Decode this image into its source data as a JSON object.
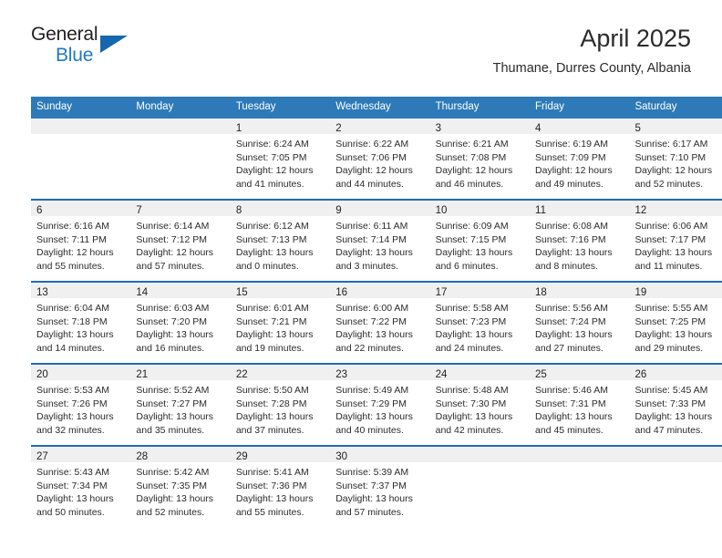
{
  "brand": {
    "line1": "General",
    "line2": "Blue",
    "triangle_color": "#1767ad",
    "blue_color": "#1f7ac0"
  },
  "header": {
    "month_title": "April 2025",
    "location": "Thumane, Durres County, Albania"
  },
  "theme": {
    "header_blue": "#2e7ab8",
    "row_border_blue": "#1f6cb0",
    "daynum_band": "#f0f0f0"
  },
  "weekday_headers": [
    "Sunday",
    "Monday",
    "Tuesday",
    "Wednesday",
    "Thursday",
    "Friday",
    "Saturday"
  ],
  "weeks": [
    [
      {
        "day": "",
        "lines": []
      },
      {
        "day": "",
        "lines": []
      },
      {
        "day": "1",
        "lines": [
          "Sunrise: 6:24 AM",
          "Sunset: 7:05 PM",
          "Daylight: 12 hours",
          "and 41 minutes."
        ]
      },
      {
        "day": "2",
        "lines": [
          "Sunrise: 6:22 AM",
          "Sunset: 7:06 PM",
          "Daylight: 12 hours",
          "and 44 minutes."
        ]
      },
      {
        "day": "3",
        "lines": [
          "Sunrise: 6:21 AM",
          "Sunset: 7:08 PM",
          "Daylight: 12 hours",
          "and 46 minutes."
        ]
      },
      {
        "day": "4",
        "lines": [
          "Sunrise: 6:19 AM",
          "Sunset: 7:09 PM",
          "Daylight: 12 hours",
          "and 49 minutes."
        ]
      },
      {
        "day": "5",
        "lines": [
          "Sunrise: 6:17 AM",
          "Sunset: 7:10 PM",
          "Daylight: 12 hours",
          "and 52 minutes."
        ]
      }
    ],
    [
      {
        "day": "6",
        "lines": [
          "Sunrise: 6:16 AM",
          "Sunset: 7:11 PM",
          "Daylight: 12 hours",
          "and 55 minutes."
        ]
      },
      {
        "day": "7",
        "lines": [
          "Sunrise: 6:14 AM",
          "Sunset: 7:12 PM",
          "Daylight: 12 hours",
          "and 57 minutes."
        ]
      },
      {
        "day": "8",
        "lines": [
          "Sunrise: 6:12 AM",
          "Sunset: 7:13 PM",
          "Daylight: 13 hours",
          "and 0 minutes."
        ]
      },
      {
        "day": "9",
        "lines": [
          "Sunrise: 6:11 AM",
          "Sunset: 7:14 PM",
          "Daylight: 13 hours",
          "and 3 minutes."
        ]
      },
      {
        "day": "10",
        "lines": [
          "Sunrise: 6:09 AM",
          "Sunset: 7:15 PM",
          "Daylight: 13 hours",
          "and 6 minutes."
        ]
      },
      {
        "day": "11",
        "lines": [
          "Sunrise: 6:08 AM",
          "Sunset: 7:16 PM",
          "Daylight: 13 hours",
          "and 8 minutes."
        ]
      },
      {
        "day": "12",
        "lines": [
          "Sunrise: 6:06 AM",
          "Sunset: 7:17 PM",
          "Daylight: 13 hours",
          "and 11 minutes."
        ]
      }
    ],
    [
      {
        "day": "13",
        "lines": [
          "Sunrise: 6:04 AM",
          "Sunset: 7:18 PM",
          "Daylight: 13 hours",
          "and 14 minutes."
        ]
      },
      {
        "day": "14",
        "lines": [
          "Sunrise: 6:03 AM",
          "Sunset: 7:20 PM",
          "Daylight: 13 hours",
          "and 16 minutes."
        ]
      },
      {
        "day": "15",
        "lines": [
          "Sunrise: 6:01 AM",
          "Sunset: 7:21 PM",
          "Daylight: 13 hours",
          "and 19 minutes."
        ]
      },
      {
        "day": "16",
        "lines": [
          "Sunrise: 6:00 AM",
          "Sunset: 7:22 PM",
          "Daylight: 13 hours",
          "and 22 minutes."
        ]
      },
      {
        "day": "17",
        "lines": [
          "Sunrise: 5:58 AM",
          "Sunset: 7:23 PM",
          "Daylight: 13 hours",
          "and 24 minutes."
        ]
      },
      {
        "day": "18",
        "lines": [
          "Sunrise: 5:56 AM",
          "Sunset: 7:24 PM",
          "Daylight: 13 hours",
          "and 27 minutes."
        ]
      },
      {
        "day": "19",
        "lines": [
          "Sunrise: 5:55 AM",
          "Sunset: 7:25 PM",
          "Daylight: 13 hours",
          "and 29 minutes."
        ]
      }
    ],
    [
      {
        "day": "20",
        "lines": [
          "Sunrise: 5:53 AM",
          "Sunset: 7:26 PM",
          "Daylight: 13 hours",
          "and 32 minutes."
        ]
      },
      {
        "day": "21",
        "lines": [
          "Sunrise: 5:52 AM",
          "Sunset: 7:27 PM",
          "Daylight: 13 hours",
          "and 35 minutes."
        ]
      },
      {
        "day": "22",
        "lines": [
          "Sunrise: 5:50 AM",
          "Sunset: 7:28 PM",
          "Daylight: 13 hours",
          "and 37 minutes."
        ]
      },
      {
        "day": "23",
        "lines": [
          "Sunrise: 5:49 AM",
          "Sunset: 7:29 PM",
          "Daylight: 13 hours",
          "and 40 minutes."
        ]
      },
      {
        "day": "24",
        "lines": [
          "Sunrise: 5:48 AM",
          "Sunset: 7:30 PM",
          "Daylight: 13 hours",
          "and 42 minutes."
        ]
      },
      {
        "day": "25",
        "lines": [
          "Sunrise: 5:46 AM",
          "Sunset: 7:31 PM",
          "Daylight: 13 hours",
          "and 45 minutes."
        ]
      },
      {
        "day": "26",
        "lines": [
          "Sunrise: 5:45 AM",
          "Sunset: 7:33 PM",
          "Daylight: 13 hours",
          "and 47 minutes."
        ]
      }
    ],
    [
      {
        "day": "27",
        "lines": [
          "Sunrise: 5:43 AM",
          "Sunset: 7:34 PM",
          "Daylight: 13 hours",
          "and 50 minutes."
        ]
      },
      {
        "day": "28",
        "lines": [
          "Sunrise: 5:42 AM",
          "Sunset: 7:35 PM",
          "Daylight: 13 hours",
          "and 52 minutes."
        ]
      },
      {
        "day": "29",
        "lines": [
          "Sunrise: 5:41 AM",
          "Sunset: 7:36 PM",
          "Daylight: 13 hours",
          "and 55 minutes."
        ]
      },
      {
        "day": "30",
        "lines": [
          "Sunrise: 5:39 AM",
          "Sunset: 7:37 PM",
          "Daylight: 13 hours",
          "and 57 minutes."
        ]
      },
      {
        "day": "",
        "lines": []
      },
      {
        "day": "",
        "lines": []
      },
      {
        "day": "",
        "lines": []
      }
    ]
  ]
}
